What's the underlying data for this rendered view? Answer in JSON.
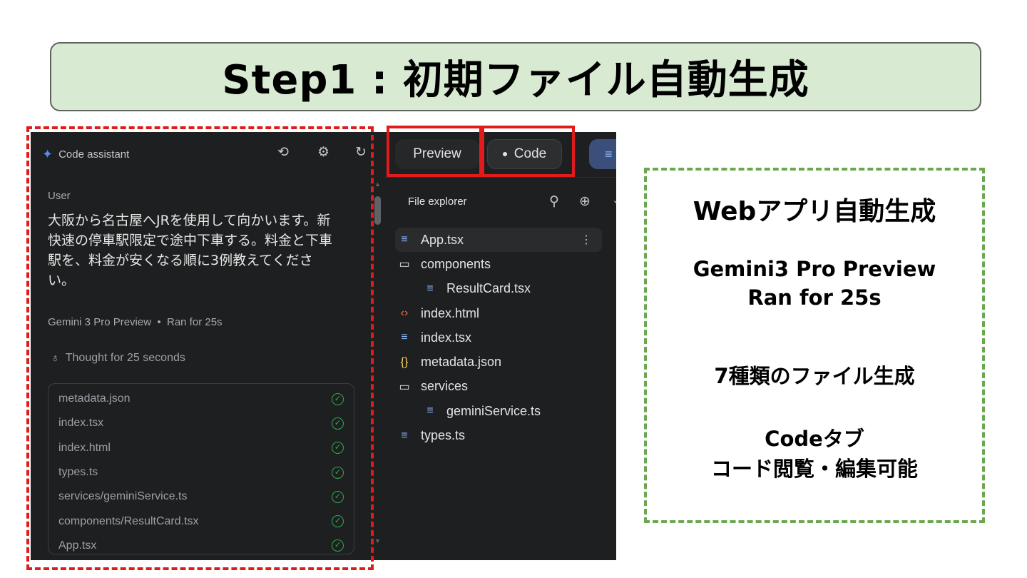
{
  "title": "Step1 : 初期ファイル自動生成",
  "chat": {
    "header_title": "Code assistant",
    "header_icons": [
      "history-icon",
      "settings-icon",
      "refresh-icon"
    ],
    "user_label": "User",
    "user_message_lines": [
      "大阪から名古屋へJRを使用して向かいます。新",
      "快速の停車駅限定で途中下車する。料金と下車",
      "駅を、料金が安くなる順に3例教えてくださ",
      "い。"
    ],
    "model": "Gemini 3 Pro Preview",
    "run_time": "Ran for 25s",
    "thought": "Thought for 25 seconds",
    "generated_files": [
      "metadata.json",
      "index.tsx",
      "index.html",
      "types.ts",
      "services/geminiService.ts",
      "components/ResultCard.tsx",
      "App.tsx"
    ],
    "status_color": "#34a853"
  },
  "pane": {
    "tabs": {
      "preview": "Preview",
      "code": "Code"
    },
    "file_explorer_title": "File explorer",
    "tree": [
      {
        "name": "App.tsx",
        "icon": "ts-file-icon"
      },
      {
        "name": "components",
        "icon": "folder-icon"
      },
      {
        "name": "ResultCard.tsx",
        "icon": "ts-file-icon"
      },
      {
        "name": "index.html",
        "icon": "html-file-icon"
      },
      {
        "name": "index.tsx",
        "icon": "ts-file-icon"
      },
      {
        "name": "metadata.json",
        "icon": "json-file-icon"
      },
      {
        "name": "services",
        "icon": "folder-icon"
      },
      {
        "name": "geminiService.ts",
        "icon": "ts-file-icon"
      },
      {
        "name": "types.ts",
        "icon": "ts-file-icon"
      }
    ]
  },
  "callout": {
    "heading": "Webアプリ自動生成",
    "model_line": "Gemini3 Pro Preview",
    "run_line": "Ran for 25s",
    "files_line": "7種類のファイル生成",
    "code_line1": "Codeタブ",
    "code_line2": "コード閲覧・編集可能"
  },
  "colors": {
    "banner_bg": "#d9ead3",
    "highlight_red": "#e01b1b",
    "callout_green": "#6aa84f",
    "ide_bg": "#1e1f20"
  }
}
